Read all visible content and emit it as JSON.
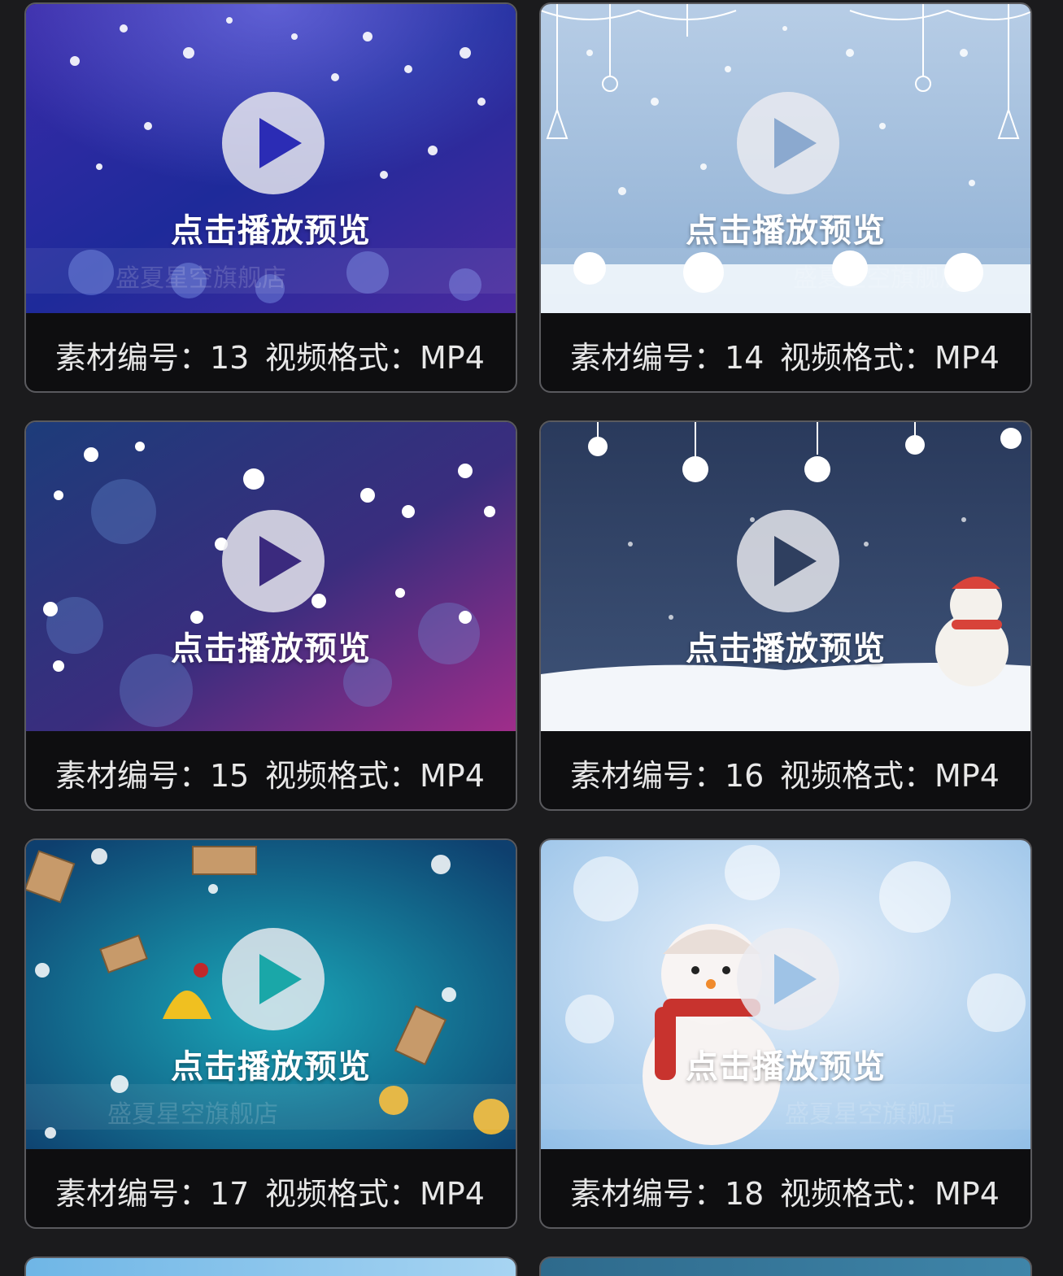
{
  "cards": [
    {
      "preview_label": "点击播放预览",
      "id_label": "素材编号：13",
      "format_label": "视频格式：MP4",
      "watermark": "盛夏星空旗舰店",
      "theme": "purple-snow"
    },
    {
      "preview_label": "点击播放预览",
      "id_label": "素材编号：14",
      "format_label": "视频格式：MP4",
      "watermark": "盛夏星空旗舰店",
      "theme": "light-blue-ornaments"
    },
    {
      "preview_label": "点击播放预览",
      "id_label": "素材编号：15",
      "format_label": "视频格式：MP4",
      "theme": "magenta-bokeh"
    },
    {
      "preview_label": "点击播放预览",
      "id_label": "素材编号：16",
      "format_label": "视频格式：MP4",
      "theme": "navy-snowman"
    },
    {
      "preview_label": "点击播放预览",
      "id_label": "素材编号：17",
      "format_label": "视频格式：MP4",
      "watermark": "盛夏星空旗舰店",
      "theme": "teal-gifts"
    },
    {
      "preview_label": "点击播放预览",
      "id_label": "素材编号：18",
      "format_label": "视频格式：MP4",
      "watermark": "盛夏星空旗舰店",
      "theme": "pale-snowman"
    }
  ],
  "icons": {
    "play": "play-icon",
    "snowflake": "snowflake-icon",
    "snowman": "snowman-icon",
    "bell": "bell-icon",
    "gift": "gift-icon"
  }
}
